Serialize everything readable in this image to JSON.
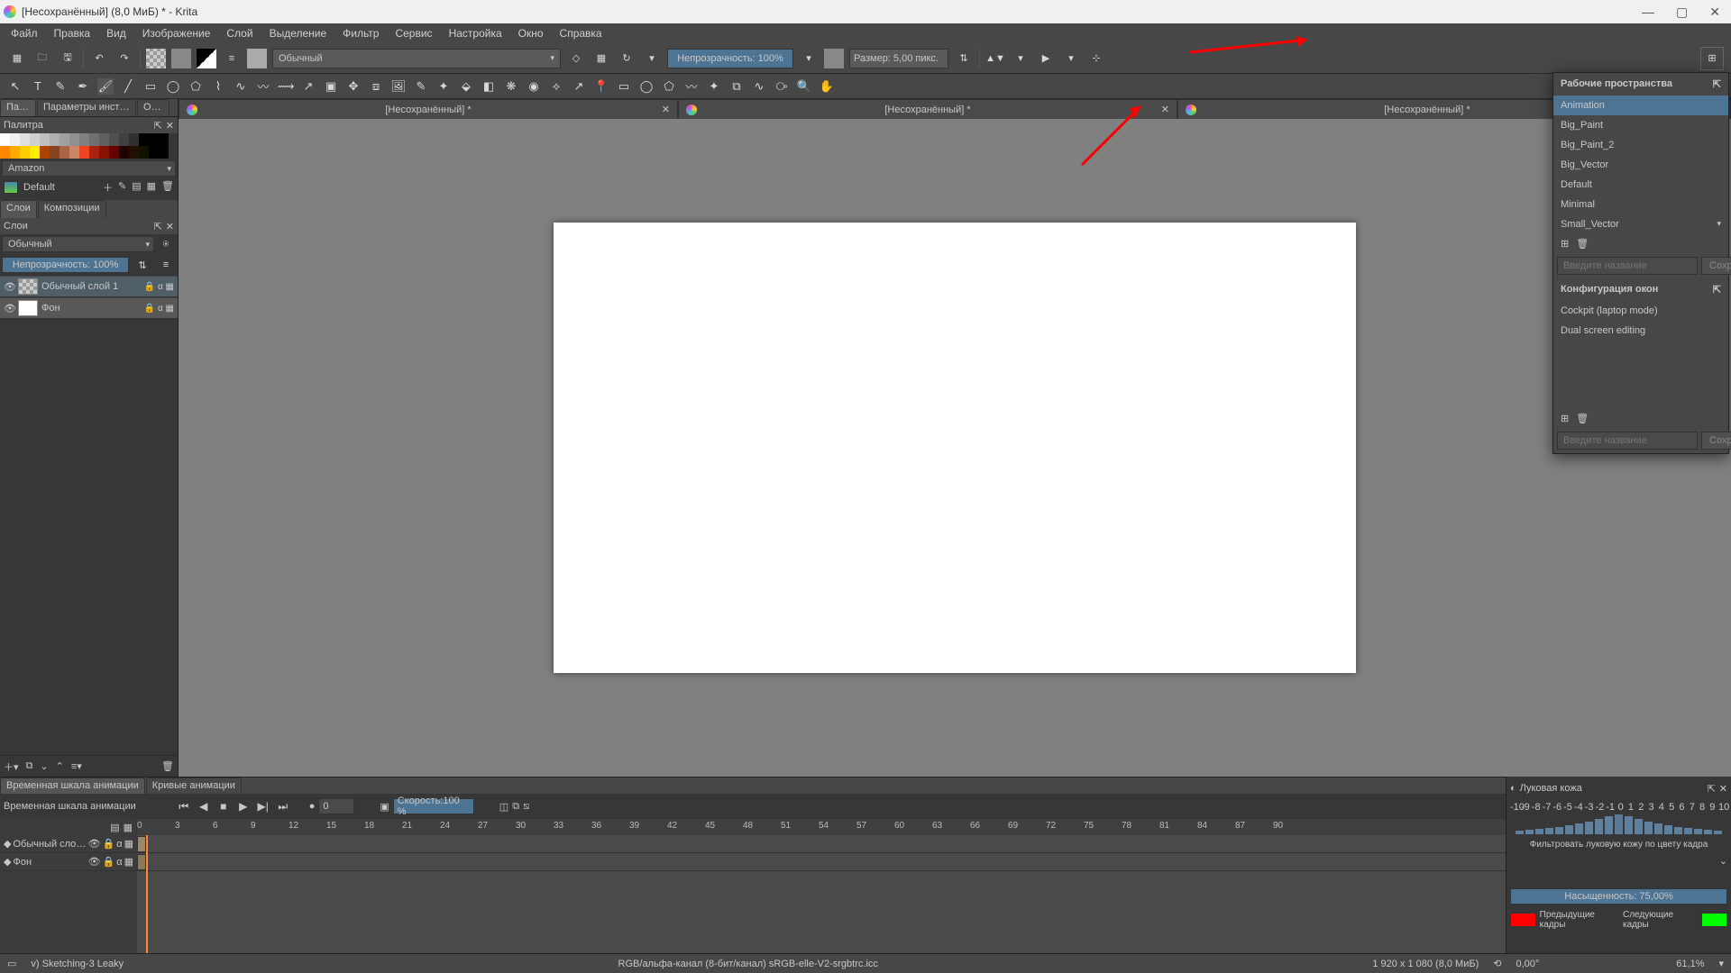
{
  "titlebar": {
    "text": "[Несохранённый]  (8,0 МиБ)  * - Krita"
  },
  "menu": [
    "Файл",
    "Правка",
    "Вид",
    "Изображение",
    "Слой",
    "Выделение",
    "Фильтр",
    "Сервис",
    "Настройка",
    "Окно",
    "Справка"
  ],
  "toolbar": {
    "blend": "Обычный",
    "opacity": "Непрозрачность: 100%",
    "size": "Размер: 5,00 пикс."
  },
  "left": {
    "tabs": [
      "Пал...",
      "Параметры инструмен...",
      "Об..."
    ],
    "header": "Палитра",
    "palette_name": "Amazon",
    "default": "Default",
    "layer_tabs": [
      "Слои",
      "Композиции"
    ],
    "layers_header": "Слои",
    "blend": "Обычный",
    "opacity": "Непрозрачность:  100%",
    "layer1": "Обычный слой 1",
    "layer2": "Фон"
  },
  "docs": [
    "[Несохранённый] *",
    "[Несохранённый] *",
    "[Несохранённый] *"
  ],
  "timeline": {
    "tabs": [
      "Временная шкала анимации",
      "Кривые анимации"
    ],
    "header": "Временная шкала анимации",
    "frame": "0",
    "speed": "Скорость:100 %",
    "layer1": "Обычный слой ...",
    "layer2": "Фон"
  },
  "onion": {
    "title": "Луковая кожа",
    "filter": "Фильтровать луковую кожу по цвету кадра",
    "sat": "Насыщенность: 75,00%",
    "prev": "Предыдущие кадры",
    "next": "Следующие кадры"
  },
  "workspace": {
    "title": "Рабочие пространства",
    "items": [
      "Animation",
      "Big_Paint",
      "Big_Paint_2",
      "Big_Vector",
      "Default",
      "Minimal",
      "Small_Vector"
    ],
    "placeholder": "Введите название",
    "save": "Сохранить",
    "section2": "Конфигурация окон",
    "items2": [
      "Cockpit (laptop mode)",
      "Dual screen editing"
    ]
  },
  "status": {
    "brush": "v) Sketching-3 Leaky",
    "color": "RGB/альфа-канал (8-бит/канал)  sRGB-elle-V2-srgbtrc.icc",
    "dims": "1 920 x 1 080 (8,0 МиБ)",
    "angle": "0,00°",
    "zoom": "61,1%"
  },
  "palette_colors": [
    "#ffffff",
    "#f0f0f0",
    "#e0e0e0",
    "#d0d0d0",
    "#c0c0c0",
    "#b0b0b0",
    "#a0a0a0",
    "#909090",
    "#808080",
    "#707070",
    "#606060",
    "#505050",
    "#404040",
    "#303030",
    "#000000",
    "#000000",
    "#000000",
    "#ff8800",
    "#ffaa00",
    "#ffcc00",
    "#ffee00",
    "#aa4400",
    "#884422",
    "#aa6644",
    "#cc8866",
    "#ee4422",
    "#aa2211",
    "#881100",
    "#660000",
    "#220000",
    "#221100",
    "#111100",
    "#000000",
    "#000000"
  ]
}
